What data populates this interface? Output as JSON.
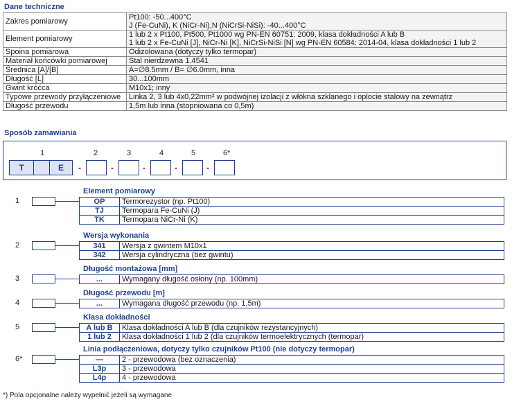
{
  "tech": {
    "title": "Dane techniczne",
    "rows": [
      {
        "label": "Zakres pomiarowy",
        "lines": [
          "Pt100: -50...400°C",
          "J (Fe-CuNi), K (NiCr-Ni),N (NiCrSi-NiSi): -40...400°C"
        ]
      },
      {
        "label": "Element pomiarowy",
        "lines": [
          "1 lub 2 x Pt100, Pt500, Pt1000 wg PN-EN 60751: 2009, klasa dokładności A lub B",
          "1 lub 2 x Fe-CuNi [J], NiCr-Ni [K], NiCrSi-NiSi [N] wg PN-EN 60584: 2014-04, klasa dokładności 1 lub 2"
        ]
      },
      {
        "label": "Spoina pomiarowa",
        "lines": [
          "Odizolowana (dotyczy tylko termopar)"
        ]
      },
      {
        "label": "Materiał końcówki pomiarowej",
        "lines": [
          "Stal nierdzewna 1.4541"
        ]
      },
      {
        "label": "Średnica [A]/[B]",
        "lines": [
          "A=∅8.5mm / B= ∅6.0mm, inna"
        ]
      },
      {
        "label": "Długość [L]",
        "lines": [
          "30...100mm"
        ]
      },
      {
        "label": "Gwint króćca",
        "lines": [
          "M10x1; inny"
        ]
      },
      {
        "label": "Typowe przewody przyłączeniowe",
        "lines": [
          "Linka 2, 3 lub 4x0,22mm² w podwójnej izolacji z włókna szklanego i oplocie stalowy na zewnątrz"
        ]
      },
      {
        "label": "Długość przewodu",
        "lines": [
          "1,5m lub inna (stopniowana co 0,5m)"
        ]
      }
    ]
  },
  "order": {
    "title": "Sposób zamawiania",
    "positions": [
      "1",
      "2",
      "3",
      "4",
      "5",
      "6*"
    ],
    "fixed_chars": [
      "T",
      "E"
    ],
    "dash": "-"
  },
  "groups": [
    {
      "num": "1",
      "title": "Element pomiarowy",
      "rows": [
        {
          "code": "OP",
          "desc": "Termorezystor (np. Pt100)"
        },
        {
          "code": "TJ",
          "desc": "Termopara Fe-CuNi (J)"
        },
        {
          "code": "TK",
          "desc": "Termopara NiCr-Ni (K)"
        }
      ]
    },
    {
      "num": "2",
      "title": "Wersja wykonania",
      "rows": [
        {
          "code": "341",
          "desc": "Wersja z gwintem M10x1"
        },
        {
          "code": "342",
          "desc": "Wersja cylindryczna (bez gwintu)"
        }
      ]
    },
    {
      "num": "3",
      "title": "Długość montażowa [mm]",
      "rows": [
        {
          "code": "...",
          "desc": "Wymagany długość osłony (np. 100mm)"
        }
      ]
    },
    {
      "num": "4",
      "title": "Długość przewodu [m]",
      "rows": [
        {
          "code": "...",
          "desc": "Wymagana długość przewodu (np. 1,5m)"
        }
      ]
    },
    {
      "num": "5",
      "title": "Klasa dokładności",
      "rows": [
        {
          "code": "A lub B",
          "desc": "Klasa dokładności A lub B (dla czujników rezystancyjnych)"
        },
        {
          "code": "1 lub 2",
          "desc": "Klasa dokładności 1 lub 2 (dla czujników termoelektrycznych (termopar)"
        }
      ]
    },
    {
      "num": "6*",
      "title": "Linia podłączeniowa, dotyczy tylko czujników Pt100 (nie dotyczy termopar)",
      "rows": [
        {
          "code": "—",
          "desc": "2 - przewodowa (bez oznaczenia)"
        },
        {
          "code": "L3p",
          "desc": "3 - przewodowa"
        },
        {
          "code": "L4p",
          "desc": "4 - przewodowa"
        }
      ]
    }
  ],
  "footnote": "*) Pola opcjonalne należy wypełnić jeżeli są wymagane",
  "colors": {
    "accent": "#1f3f8f",
    "code_fill": "#dbe3f4"
  }
}
